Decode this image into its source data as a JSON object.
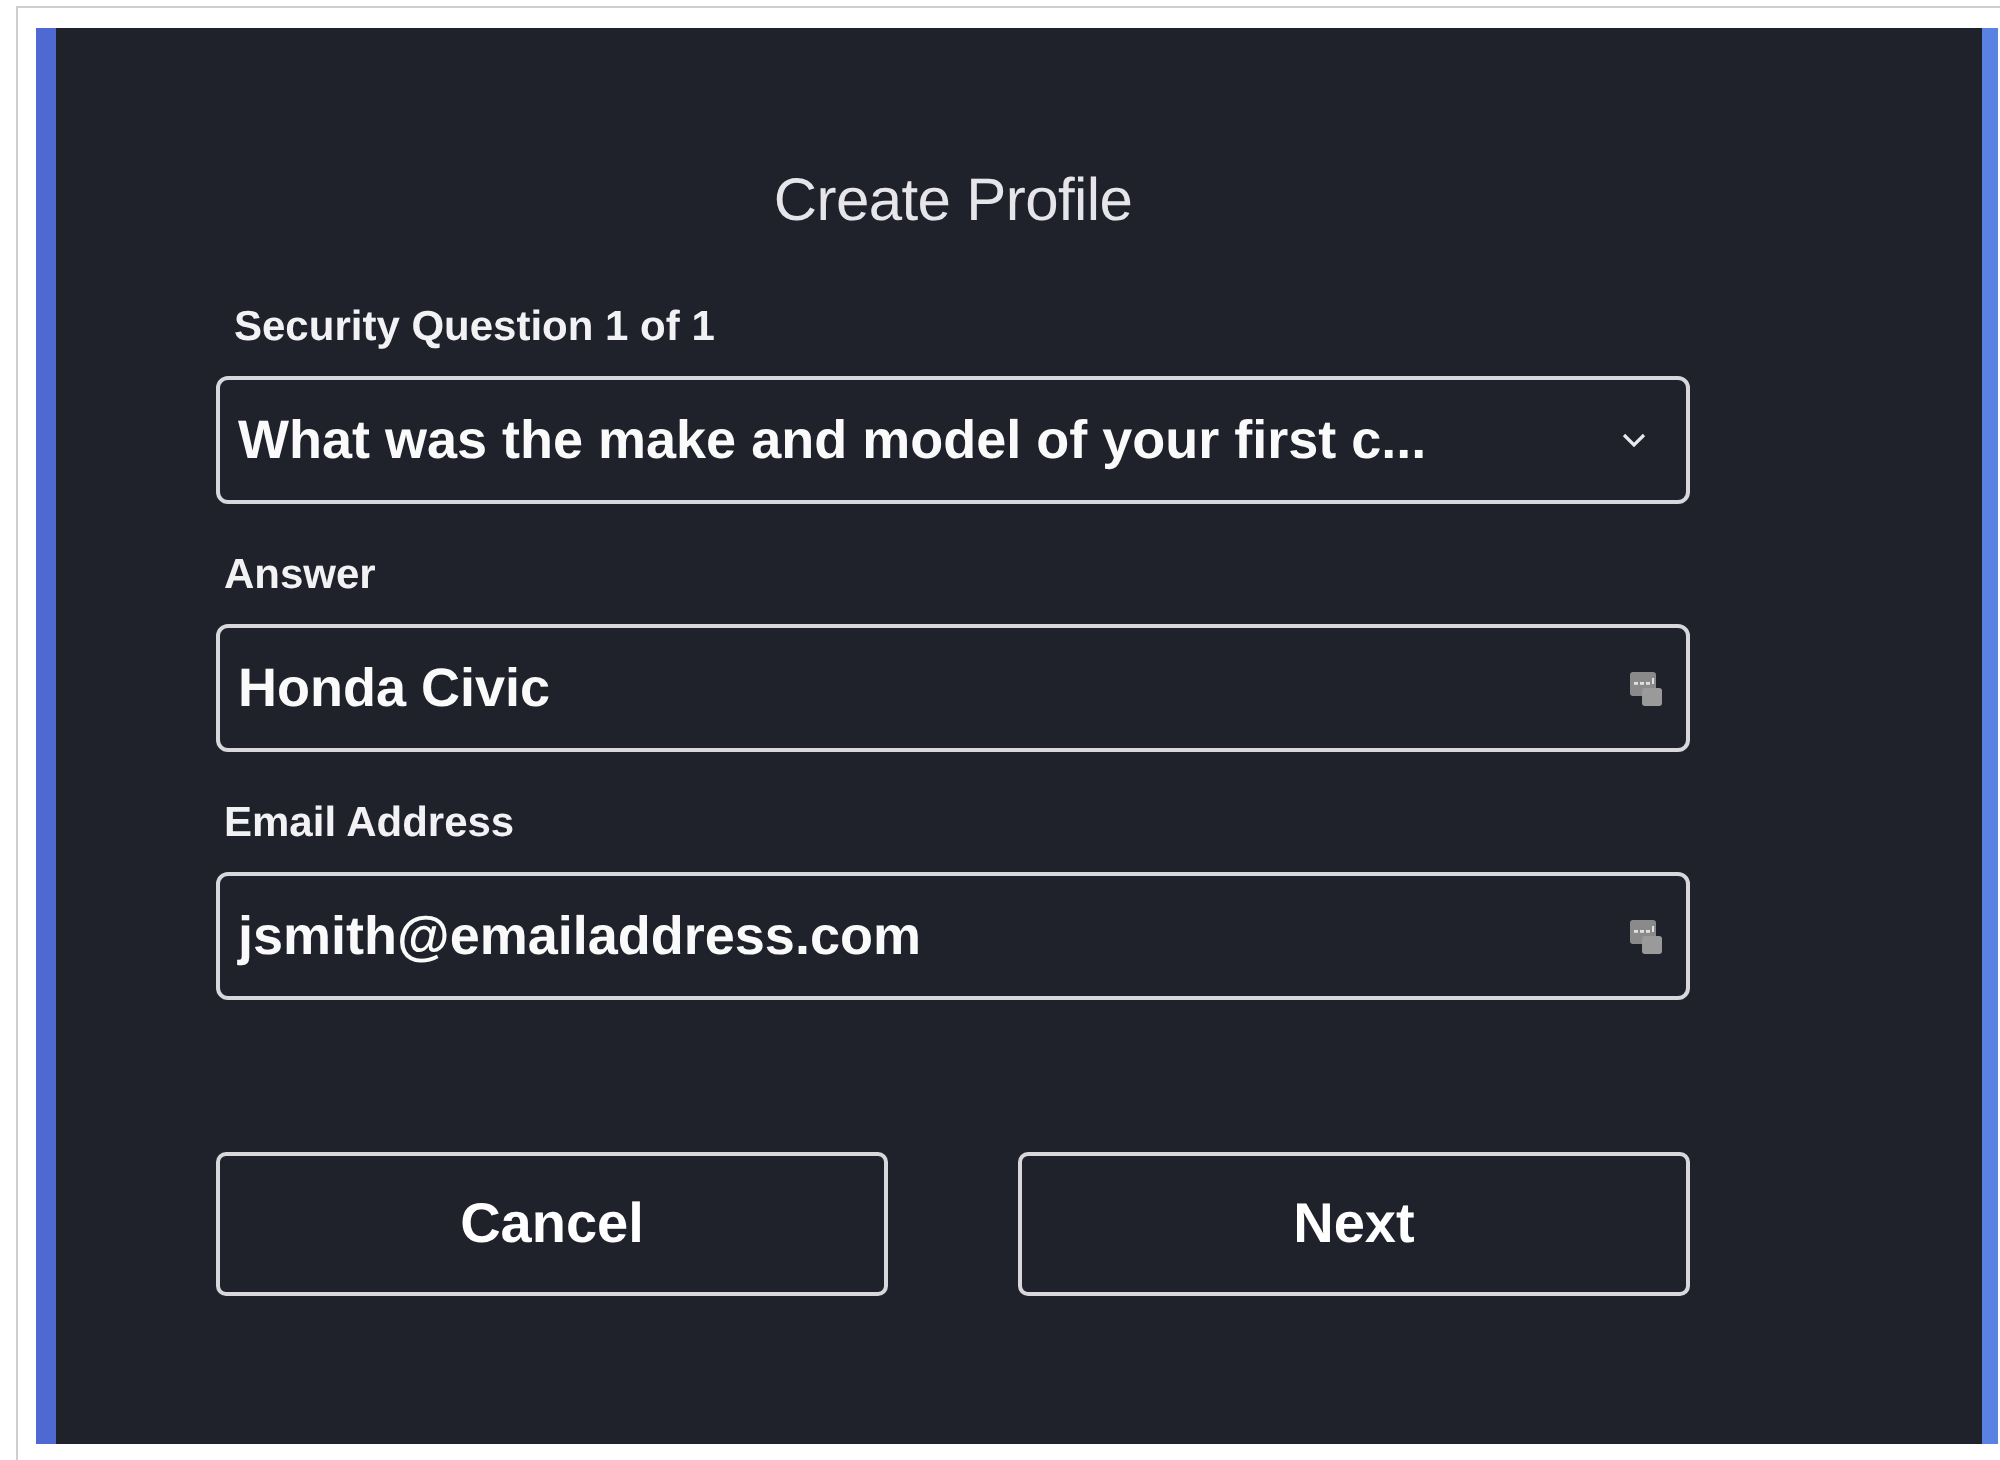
{
  "dialog": {
    "title": "Create Profile"
  },
  "fields": [
    {
      "kind": "select",
      "label": "Security Question 1 of 1",
      "value": "What was the make and model of your first c..."
    },
    {
      "kind": "text",
      "label": "Answer",
      "value": "Honda Civic"
    },
    {
      "kind": "text",
      "label": "Email Address",
      "value": "jsmith@emailaddress.com"
    }
  ],
  "buttons": [
    "Cancel",
    "Next"
  ]
}
